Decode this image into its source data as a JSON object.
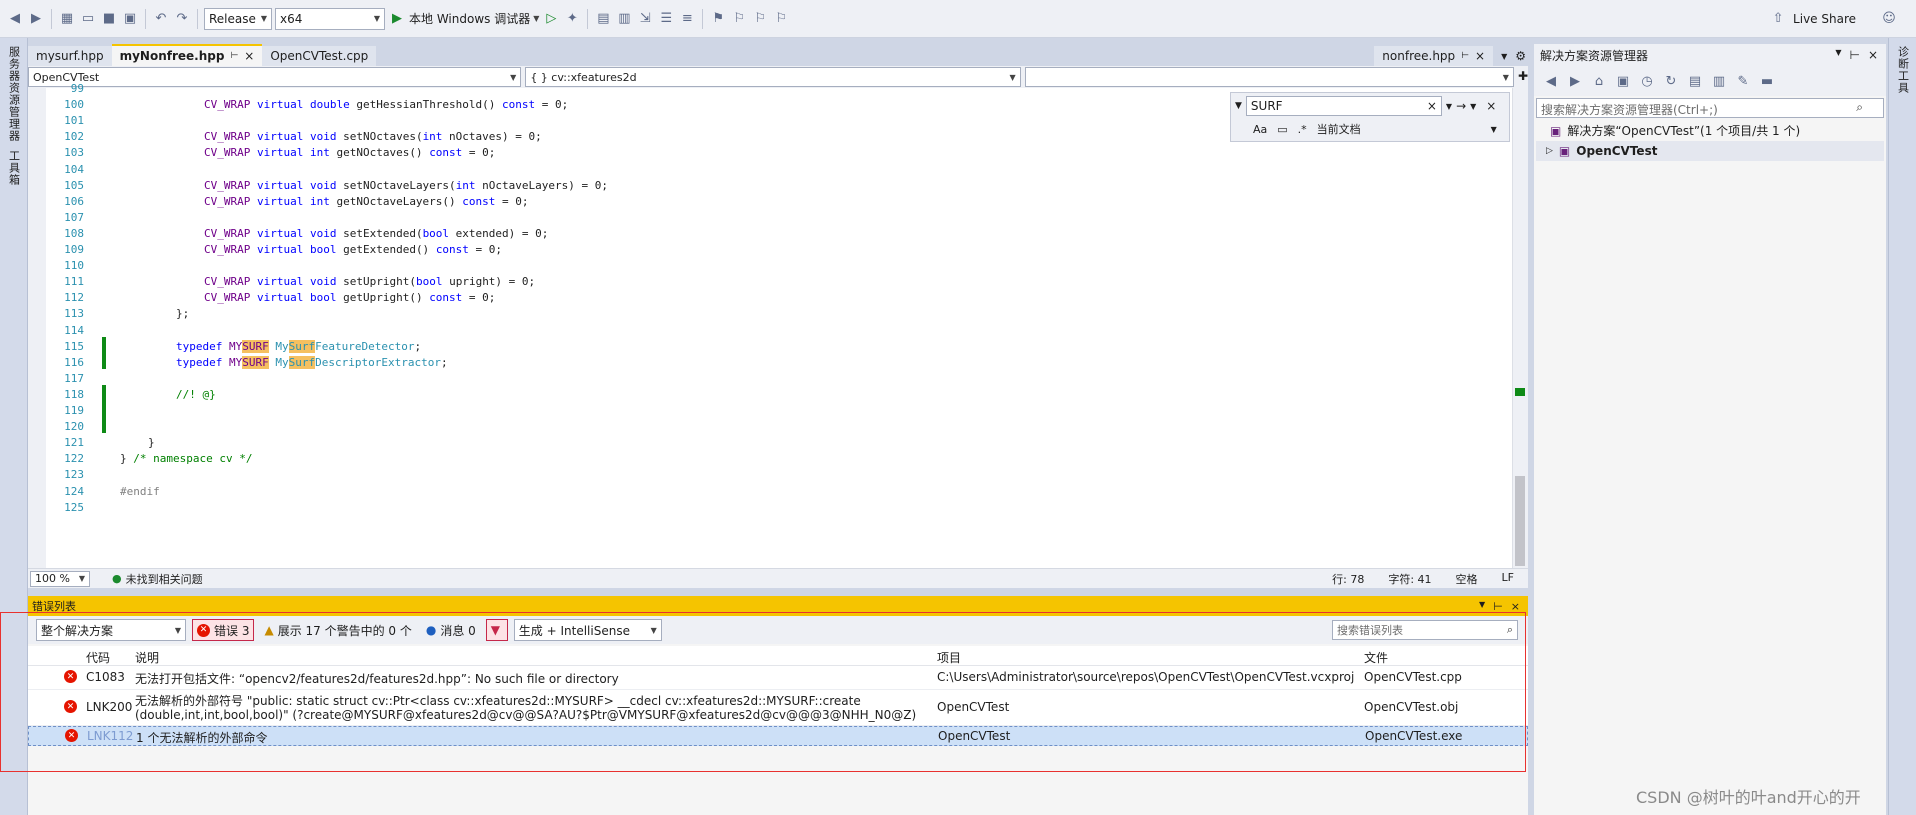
{
  "toolbar": {
    "config": "Release",
    "platform": "x64",
    "run_label": "本地 Windows 调试器",
    "live_share": "Live Share"
  },
  "leftbar": {
    "items": [
      "服务器资源管理器",
      "工具箱"
    ]
  },
  "rightbar": {
    "items": [
      "诊断工具"
    ]
  },
  "tabs": [
    {
      "label": "mysurf.hpp"
    },
    {
      "label": "myNonfree.hpp"
    },
    {
      "label": "OpenCVTest.cpp"
    }
  ],
  "right_tab": {
    "label": "nonfree.hpp"
  },
  "navbar": {
    "project": "OpenCVTest",
    "scope": "{ } cv::xfeatures2d",
    "member": ""
  },
  "find": {
    "value": "SURF",
    "scope": "当前文档"
  },
  "code": [
    {
      "n": "99",
      "t": ""
    },
    {
      "n": "100",
      "t": "CV_WRAP virtual double getHessianThreshold() const = 0;"
    },
    {
      "n": "101",
      "t": ""
    },
    {
      "n": "102",
      "t": "CV_WRAP virtual void setNOctaves(int nOctaves) = 0;"
    },
    {
      "n": "103",
      "t": "CV_WRAP virtual int getNOctaves() const = 0;"
    },
    {
      "n": "104",
      "t": ""
    },
    {
      "n": "105",
      "t": "CV_WRAP virtual void setNOctaveLayers(int nOctaveLayers) = 0;"
    },
    {
      "n": "106",
      "t": "CV_WRAP virtual int getNOctaveLayers() const = 0;"
    },
    {
      "n": "107",
      "t": ""
    },
    {
      "n": "108",
      "t": "CV_WRAP virtual void setExtended(bool extended) = 0;"
    },
    {
      "n": "109",
      "t": "CV_WRAP virtual bool getExtended() const = 0;"
    },
    {
      "n": "110",
      "t": ""
    },
    {
      "n": "111",
      "t": "CV_WRAP virtual void setUpright(bool upright) = 0;"
    },
    {
      "n": "112",
      "t": "CV_WRAP virtual bool getUpright() const = 0;"
    },
    {
      "n": "113",
      "t": "};"
    },
    {
      "n": "114",
      "t": ""
    },
    {
      "n": "115",
      "t": "typedef MYSURF MySurfFeatureDetector;"
    },
    {
      "n": "116",
      "t": "typedef MYSURF MySurfDescriptorExtractor;"
    },
    {
      "n": "117",
      "t": ""
    },
    {
      "n": "118",
      "t": "//! @}"
    },
    {
      "n": "119",
      "t": ""
    },
    {
      "n": "120",
      "t": ""
    },
    {
      "n": "121",
      "t": "}"
    },
    {
      "n": "122",
      "t": "} /* namespace cv */"
    },
    {
      "n": "123",
      "t": ""
    },
    {
      "n": "124",
      "t": "#endif"
    },
    {
      "n": "125",
      "t": ""
    }
  ],
  "status": {
    "zoom": "100 %",
    "issues": "未找到相关问题",
    "line": "行: 78",
    "col": "字符: 41",
    "ws": "空格",
    "eol": "LF"
  },
  "errlist": {
    "title": "错误列表",
    "scope": "整个解决方案",
    "errors": "错误 3",
    "warnings": "展示 17 个警告中的 0 个",
    "messages": "消息 0",
    "build": "生成 + IntelliSense",
    "search_placeholder": "搜索错误列表",
    "headers": {
      "code": "代码",
      "desc": "说明",
      "project": "项目",
      "file": "文件"
    },
    "rows": [
      {
        "code": "C1083",
        "desc": "无法打开包括文件: “opencv2/features2d/features2d.hpp”: No such file or directory",
        "desc2": "",
        "project": "C:\\Users\\Administrator\\source\\repos\\OpenCVTest\\OpenCVTest.vcxproj",
        "file": "OpenCVTest.cpp"
      },
      {
        "code": "LNK200",
        "desc": "无法解析的外部符号 \"public: static struct cv::Ptr<class cv::xfeatures2d::MYSURF> __cdecl cv::xfeatures2d::MYSURF::create",
        "desc2": "(double,int,int,bool,bool)\" (?create@MYSURF@xfeatures2d@cv@@SA?AU?$Ptr@VMYSURF@xfeatures2d@cv@@@3@NHH_N0@Z)",
        "project": "OpenCVTest",
        "file": "OpenCVTest.obj"
      },
      {
        "code": "LNK112",
        "desc": "1 个无法解析的外部命令",
        "desc2": "",
        "project": "OpenCVTest",
        "file": "OpenCVTest.exe"
      }
    ]
  },
  "solution": {
    "title": "解决方案资源管理器",
    "search_placeholder": "搜索解决方案资源管理器(Ctrl+;)",
    "root": "解决方案“OpenCVTest”(1 个项目/共 1 个)",
    "project": "OpenCVTest"
  },
  "watermark": "CSDN @树叶的叶and开心的开"
}
